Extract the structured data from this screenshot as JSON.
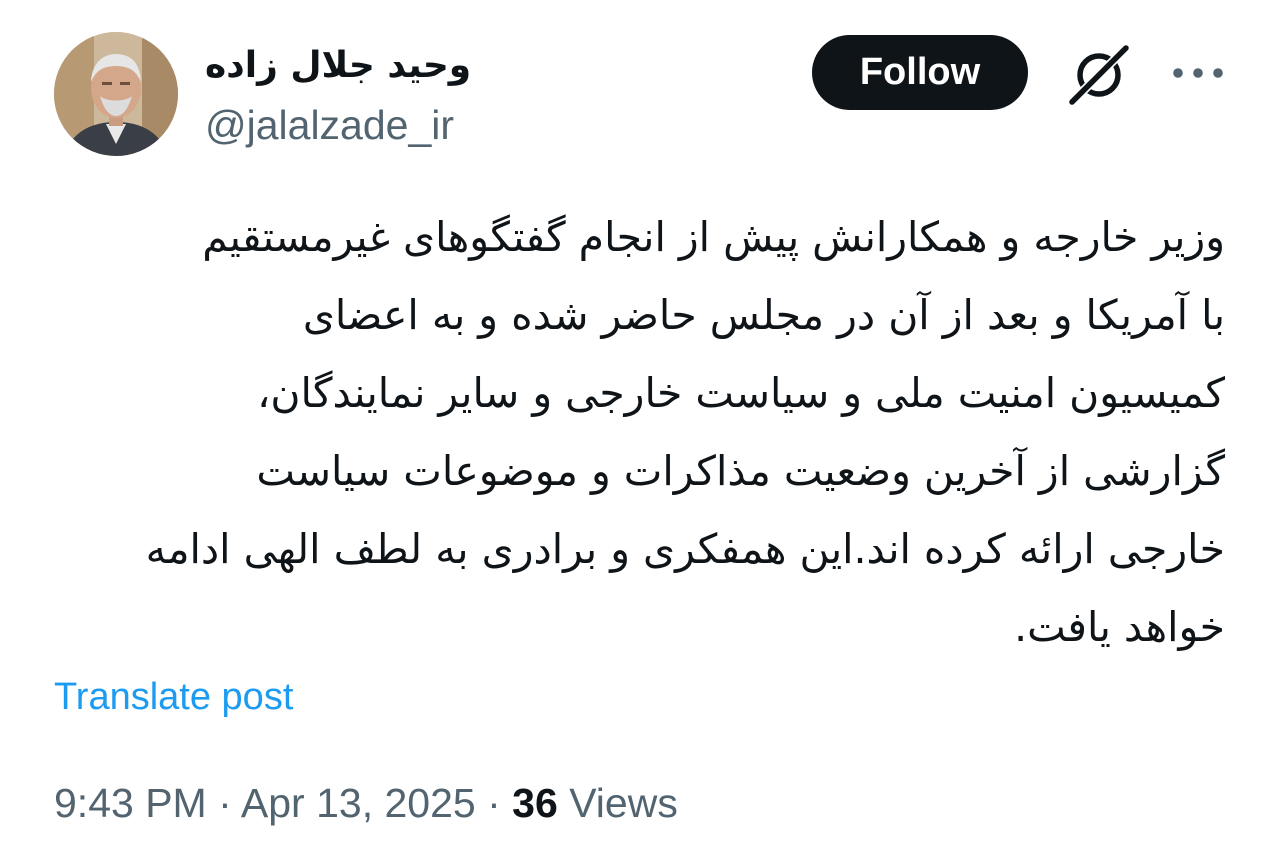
{
  "author": {
    "display_name": "وحید جلال زاده",
    "handle": "@jalalzade_ir",
    "avatar": "user-portrait"
  },
  "actions": {
    "follow_label": "Follow",
    "grok_icon": "grok-icon",
    "more_icon": "more-horizontal-icon"
  },
  "post": {
    "text": "وزیر خارجه و همکارانش پیش از انجام گفتگوهای غیرمستقیم\nبا آمریکا و بعد از آن در مجلس حاضر شده و به اعضای\nکمیسیون امنیت ملی و سیاست خارجی و سایر نمایندگان،\nگزارشی از آخرین وضعیت مذاکرات و موضوعات سیاست\nخارجی ارائه کرده اند.این همفکری و برادری به لطف الهی ادامه\nخواهد یافت."
  },
  "translate_label": "Translate post",
  "meta": {
    "time": "9:43 PM",
    "separator": "·",
    "date": "Apr 13, 2025",
    "views_count": "36",
    "views_label": "Views"
  },
  "colors": {
    "text": "#0f1419",
    "secondary": "#536471",
    "link": "#1d9bf0",
    "button_bg": "#0f1419"
  }
}
